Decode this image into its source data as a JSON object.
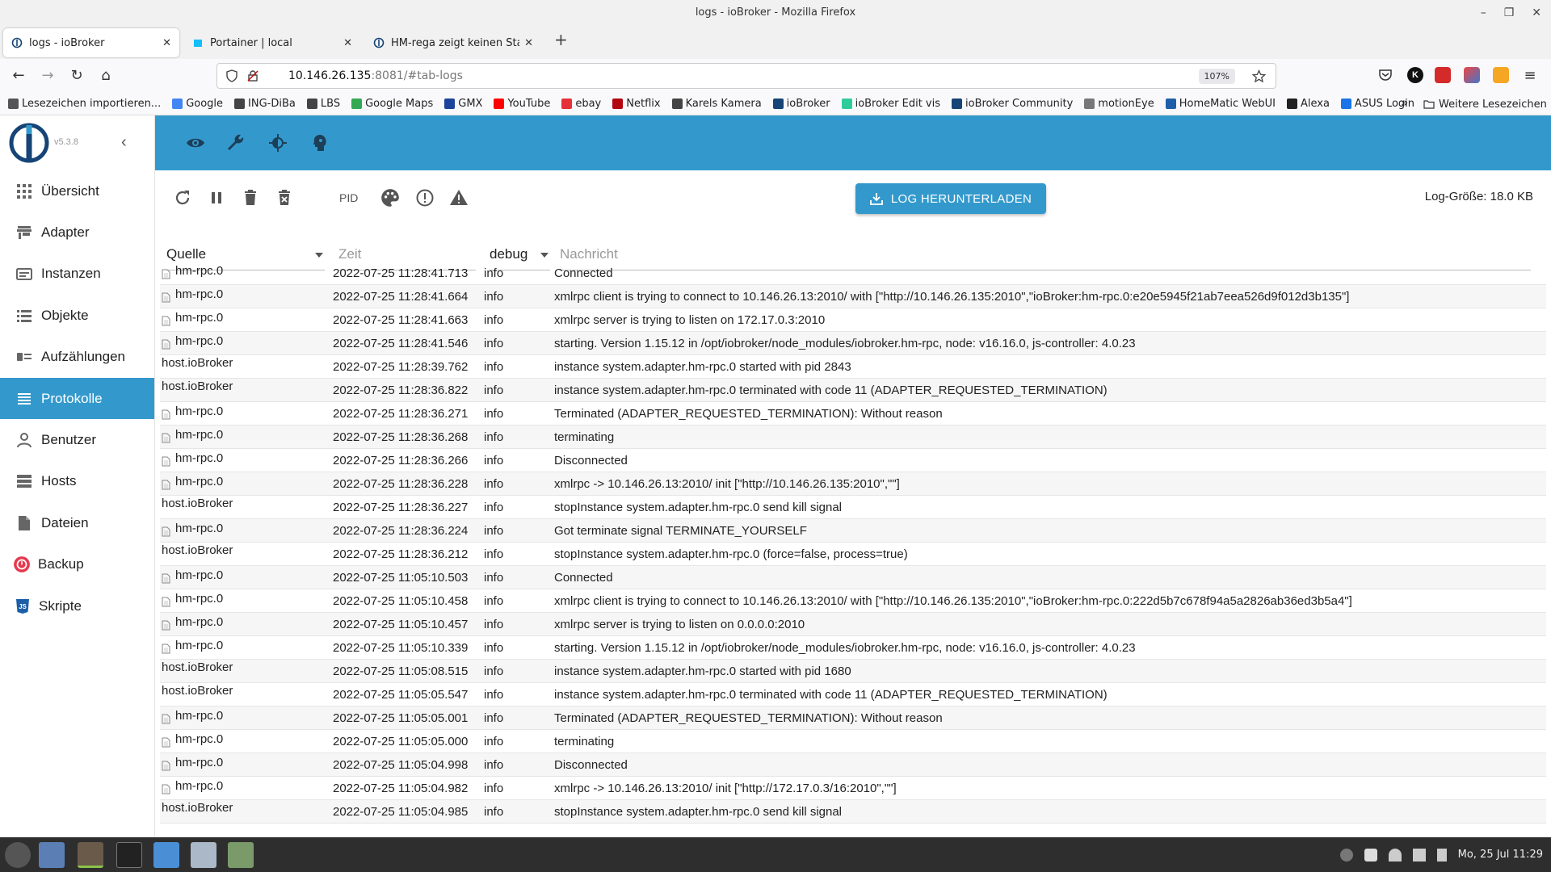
{
  "window": {
    "title": "logs - ioBroker - Mozilla Firefox"
  },
  "tabs": [
    {
      "label": "logs - ioBroker",
      "active": true,
      "icon": "iobroker-icon"
    },
    {
      "label": "Portainer | local",
      "active": false,
      "icon": "portainer-icon"
    },
    {
      "label": "HM-rega zeigt keinen Status",
      "active": false,
      "icon": "iobroker-icon"
    }
  ],
  "url": {
    "host": "10.146.26.135",
    "rest": ":8081/#tab-logs",
    "zoom": "107%"
  },
  "bookmarks": [
    {
      "label": "Lesezeichen importieren...",
      "color": "#555555"
    },
    {
      "label": "Google",
      "color": "#4285f4"
    },
    {
      "label": "ING-DiBa",
      "color": "#444444"
    },
    {
      "label": "LBS",
      "color": "#444444"
    },
    {
      "label": "Google Maps",
      "color": "#34a853"
    },
    {
      "label": "GMX",
      "color": "#1c449b"
    },
    {
      "label": "YouTube",
      "color": "#ff0000"
    },
    {
      "label": "ebay",
      "color": "#e53238"
    },
    {
      "label": "Netflix",
      "color": "#b20710"
    },
    {
      "label": "Karels Kamera",
      "color": "#444444"
    },
    {
      "label": "ioBroker",
      "color": "#164477"
    },
    {
      "label": "ioBroker Edit vis",
      "color": "#2ecc9a"
    },
    {
      "label": "ioBroker Community",
      "color": "#164477"
    },
    {
      "label": "motionEye",
      "color": "#777777"
    },
    {
      "label": "HomeMatic WebUI",
      "color": "#1e5fa8"
    },
    {
      "label": "Alexa",
      "color": "#222222"
    },
    {
      "label": "ASUS Login",
      "color": "#1a73e8"
    }
  ],
  "bookmarks_folder": "Weitere Lesezeichen",
  "app": {
    "version": "v5.3.8",
    "accent": "#3399cc",
    "nav": [
      {
        "label": "Übersicht",
        "icon": "grid-icon",
        "active": false
      },
      {
        "label": "Adapter",
        "icon": "store-icon",
        "active": false
      },
      {
        "label": "Instanzen",
        "icon": "instances-icon",
        "active": false
      },
      {
        "label": "Objekte",
        "icon": "list-icon",
        "active": false
      },
      {
        "label": "Aufzählungen",
        "icon": "enum-icon",
        "active": false
      },
      {
        "label": "Protokolle",
        "icon": "logs-icon",
        "active": true
      },
      {
        "label": "Benutzer",
        "icon": "user-icon",
        "active": false
      },
      {
        "label": "Hosts",
        "icon": "hosts-icon",
        "active": false
      },
      {
        "label": "Dateien",
        "icon": "file-icon",
        "active": false
      },
      {
        "label": "Backup",
        "icon": "backup-icon",
        "active": false
      },
      {
        "label": "Skripte",
        "icon": "js-icon",
        "active": false
      }
    ]
  },
  "logs": {
    "toolbar": {
      "pid_label": "PID",
      "download_label": "LOG HERUNTERLADEN",
      "size_label": "Log-Größe: 18.0 KB"
    },
    "headers": {
      "source": "Quelle",
      "time": "Zeit",
      "severity": "debug",
      "message": "Nachricht"
    },
    "rows": [
      {
        "source": "hm-rpc.0",
        "time": "2022-07-25 11:28:41.713",
        "severity": "info",
        "message": "Connected",
        "instance": true
      },
      {
        "source": "hm-rpc.0",
        "time": "2022-07-25 11:28:41.664",
        "severity": "info",
        "message": "xmlrpc client is trying to connect to 10.146.26.13:2010/ with [\"http://10.146.26.135:2010\",\"ioBroker:hm-rpc.0:e20e5945f21ab7eea526d9f012d3b135\"]",
        "instance": true
      },
      {
        "source": "hm-rpc.0",
        "time": "2022-07-25 11:28:41.663",
        "severity": "info",
        "message": "xmlrpc server is trying to listen on 172.17.0.3:2010",
        "instance": true
      },
      {
        "source": "hm-rpc.0",
        "time": "2022-07-25 11:28:41.546",
        "severity": "info",
        "message": "starting. Version 1.15.12 in /opt/iobroker/node_modules/iobroker.hm-rpc, node: v16.16.0, js-controller: 4.0.23",
        "instance": true
      },
      {
        "source": "host.ioBroker",
        "time": "2022-07-25 11:28:39.762",
        "severity": "info",
        "message": "instance system.adapter.hm-rpc.0 started with pid 2843",
        "instance": false
      },
      {
        "source": "host.ioBroker",
        "time": "2022-07-25 11:28:36.822",
        "severity": "info",
        "message": "instance system.adapter.hm-rpc.0 terminated with code 11 (ADAPTER_REQUESTED_TERMINATION)",
        "instance": false
      },
      {
        "source": "hm-rpc.0",
        "time": "2022-07-25 11:28:36.271",
        "severity": "info",
        "message": "Terminated (ADAPTER_REQUESTED_TERMINATION): Without reason",
        "instance": true
      },
      {
        "source": "hm-rpc.0",
        "time": "2022-07-25 11:28:36.268",
        "severity": "info",
        "message": "terminating",
        "instance": true
      },
      {
        "source": "hm-rpc.0",
        "time": "2022-07-25 11:28:36.266",
        "severity": "info",
        "message": "Disconnected",
        "instance": true
      },
      {
        "source": "hm-rpc.0",
        "time": "2022-07-25 11:28:36.228",
        "severity": "info",
        "message": "xmlrpc -> 10.146.26.13:2010/ init [\"http://10.146.26.135:2010\",\"\"]",
        "instance": true
      },
      {
        "source": "host.ioBroker",
        "time": "2022-07-25 11:28:36.227",
        "severity": "info",
        "message": "stopInstance system.adapter.hm-rpc.0 send kill signal",
        "instance": false
      },
      {
        "source": "hm-rpc.0",
        "time": "2022-07-25 11:28:36.224",
        "severity": "info",
        "message": "Got terminate signal TERMINATE_YOURSELF",
        "instance": true
      },
      {
        "source": "host.ioBroker",
        "time": "2022-07-25 11:28:36.212",
        "severity": "info",
        "message": "stopInstance system.adapter.hm-rpc.0 (force=false, process=true)",
        "instance": false
      },
      {
        "source": "hm-rpc.0",
        "time": "2022-07-25 11:05:10.503",
        "severity": "info",
        "message": "Connected",
        "instance": true
      },
      {
        "source": "hm-rpc.0",
        "time": "2022-07-25 11:05:10.458",
        "severity": "info",
        "message": "xmlrpc client is trying to connect to 10.146.26.13:2010/ with [\"http://10.146.26.135:2010\",\"ioBroker:hm-rpc.0:222d5b7c678f94a5a2826ab36ed3b5a4\"]",
        "instance": true
      },
      {
        "source": "hm-rpc.0",
        "time": "2022-07-25 11:05:10.457",
        "severity": "info",
        "message": "xmlrpc server is trying to listen on 0.0.0.0:2010",
        "instance": true
      },
      {
        "source": "hm-rpc.0",
        "time": "2022-07-25 11:05:10.339",
        "severity": "info",
        "message": "starting. Version 1.15.12 in /opt/iobroker/node_modules/iobroker.hm-rpc, node: v16.16.0, js-controller: 4.0.23",
        "instance": true
      },
      {
        "source": "host.ioBroker",
        "time": "2022-07-25 11:05:08.515",
        "severity": "info",
        "message": "instance system.adapter.hm-rpc.0 started with pid 1680",
        "instance": false
      },
      {
        "source": "host.ioBroker",
        "time": "2022-07-25 11:05:05.547",
        "severity": "info",
        "message": "instance system.adapter.hm-rpc.0 terminated with code 11 (ADAPTER_REQUESTED_TERMINATION)",
        "instance": false
      },
      {
        "source": "hm-rpc.0",
        "time": "2022-07-25 11:05:05.001",
        "severity": "info",
        "message": "Terminated (ADAPTER_REQUESTED_TERMINATION): Without reason",
        "instance": true
      },
      {
        "source": "hm-rpc.0",
        "time": "2022-07-25 11:05:05.000",
        "severity": "info",
        "message": "terminating",
        "instance": true
      },
      {
        "source": "hm-rpc.0",
        "time": "2022-07-25 11:05:04.998",
        "severity": "info",
        "message": "Disconnected",
        "instance": true
      },
      {
        "source": "hm-rpc.0",
        "time": "2022-07-25 11:05:04.982",
        "severity": "info",
        "message": "xmlrpc -> 10.146.26.13:2010/ init [\"http://172.17.0.3/16:2010\",\"\"]",
        "instance": true
      },
      {
        "source": "host.ioBroker",
        "time": "2022-07-25 11:05:04.985",
        "severity": "info",
        "message": "stopInstance system.adapter.hm-rpc.0 send kill signal",
        "instance": false
      }
    ]
  },
  "taskbar": {
    "clock": "Mo, 25 Jul 11:29"
  }
}
